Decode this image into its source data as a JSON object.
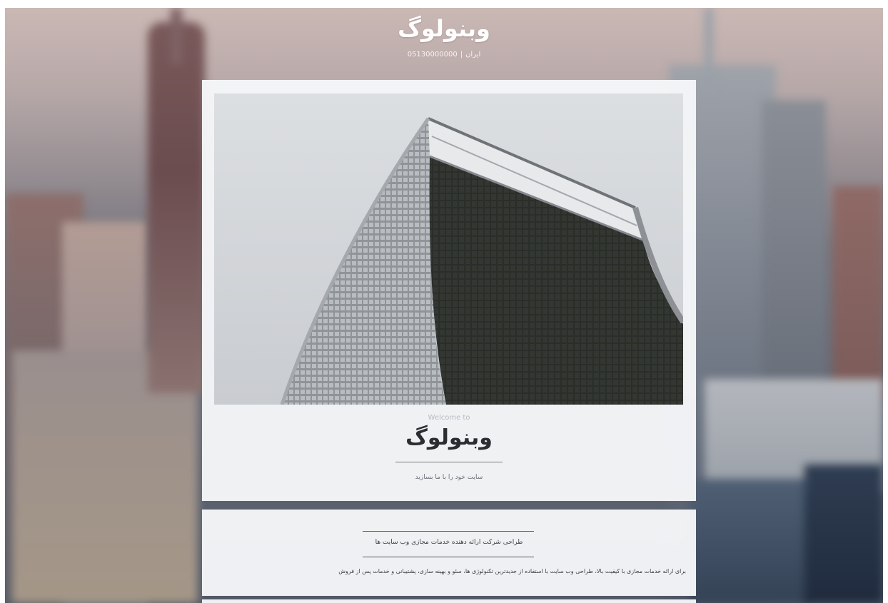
{
  "header": {
    "site_title": "وبنولوگ",
    "phone": "05130000000",
    "city": "ایران"
  },
  "hero": {
    "image_alt": "skyscraper-photo"
  },
  "welcome": {
    "subtitle": "Welcome to",
    "title": "وبنولوگ",
    "tagline": "سایت خود را با ما بسازید"
  },
  "about": {
    "title": "طراحی شرکت ارائه دهنده خدمات مجازی وب سایت ها",
    "body": "برای ارائه خدمات مجازی با کیفیت بالا، طراحی وب سایت با استفاده از جدیدترین تکنولوژی ها، سئو و بهینه سازی، پشتیبانی و خدمات پس از فروش"
  },
  "colors": {
    "panel": "#f6f7f9",
    "title_text": "#2b2d31",
    "header_text": "#ffffff"
  }
}
